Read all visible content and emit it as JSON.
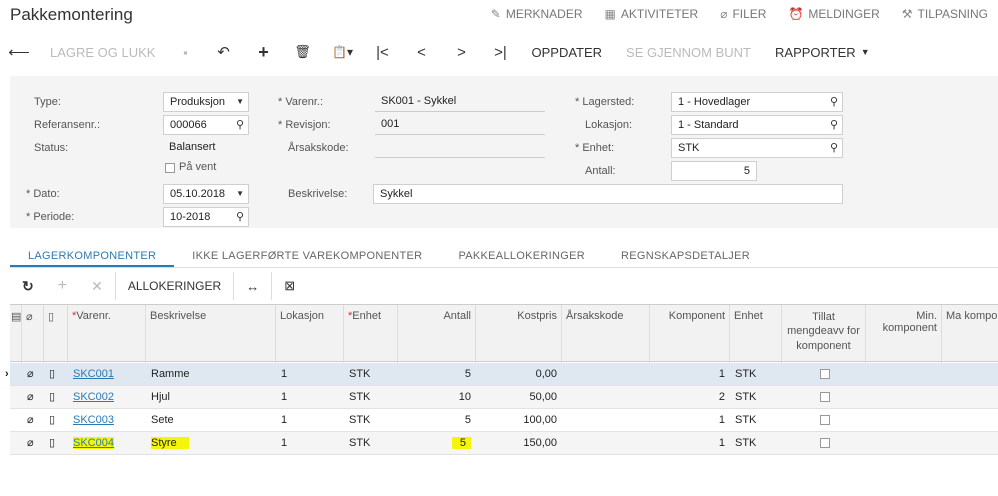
{
  "title": "Pakkemontering",
  "toplinks": [
    {
      "icon": "edit-icon",
      "glyph": "✎",
      "label": "MERKNADER"
    },
    {
      "icon": "calendar-icon",
      "glyph": "▦",
      "label": "AKTIVITETER"
    },
    {
      "icon": "paperclip-icon",
      "glyph": "⌀",
      "label": "FILER"
    },
    {
      "icon": "alarm-icon",
      "glyph": "⏰",
      "label": "MELDINGER"
    },
    {
      "icon": "tools-icon",
      "glyph": "⚒",
      "label": "TILPASNING"
    }
  ],
  "toolbar": {
    "save_close": "LAGRE OG LUKK",
    "refresh": "OPPDATER",
    "batch": "SE GJENNOM BUNT",
    "reports": "RAPPORTER"
  },
  "form": {
    "type_label": "Type:",
    "type_value": "Produksjon",
    "ref_label": "Referansenr.:",
    "ref_value": "000066",
    "status_label": "Status:",
    "status_value": "Balansert",
    "hold_label": "På vent",
    "date_label": "Dato:",
    "date_value": "05.10.2018",
    "period_label": "Periode:",
    "period_value": "10-2018",
    "item_label": "Varenr.:",
    "item_value": "SK001 - Sykkel",
    "rev_label": "Revisjon:",
    "rev_value": "001",
    "reason_label": "Årsakskode:",
    "reason_value": "",
    "desc_label": "Beskrivelse:",
    "desc_value": "Sykkel",
    "warehouse_label": "Lagersted:",
    "warehouse_value": "1 - Hovedlager",
    "location_label": "Lokasjon:",
    "location_value": "1 - Standard",
    "uom_label": "Enhet:",
    "uom_value": "STK",
    "qty_label": "Antall:",
    "qty_value": "5"
  },
  "tabs": [
    "LAGERKOMPONENTER",
    "IKKE LAGERFØRTE VAREKOMPONENTER",
    "PAKKEALLOKERINGER",
    "REGNSKAPSDETALJER"
  ],
  "gridbar": {
    "allocations": "ALLOKERINGER"
  },
  "grid": {
    "headers": {
      "item": "Varenr.",
      "desc": "Beskrivelse",
      "location": "Lokasjon",
      "uom": "Enhet",
      "qty": "Antall",
      "cost": "Kostpris",
      "reason": "Årsakskode",
      "component": "Komponent",
      "uom2": "Enhet",
      "allow": "Tillat mengdeavv for komponent",
      "min": "Min. komponent",
      "max": "Ma kompone"
    },
    "rows": [
      {
        "item": "SKC001",
        "desc": "Ramme",
        "location": "1",
        "uom": "STK",
        "qty": "5",
        "cost": "0,00",
        "component": "1",
        "uom2": "STK"
      },
      {
        "item": "SKC002",
        "desc": "Hjul",
        "location": "1",
        "uom": "STK",
        "qty": "10",
        "cost": "50,00",
        "component": "2",
        "uom2": "STK"
      },
      {
        "item": "SKC003",
        "desc": "Sete",
        "location": "1",
        "uom": "STK",
        "qty": "5",
        "cost": "100,00",
        "component": "1",
        "uom2": "STK"
      },
      {
        "item": "SKC004",
        "desc": "Styre",
        "location": "1",
        "uom": "STK",
        "qty": "5",
        "cost": "150,00",
        "component": "1",
        "uom2": "STK"
      }
    ]
  }
}
